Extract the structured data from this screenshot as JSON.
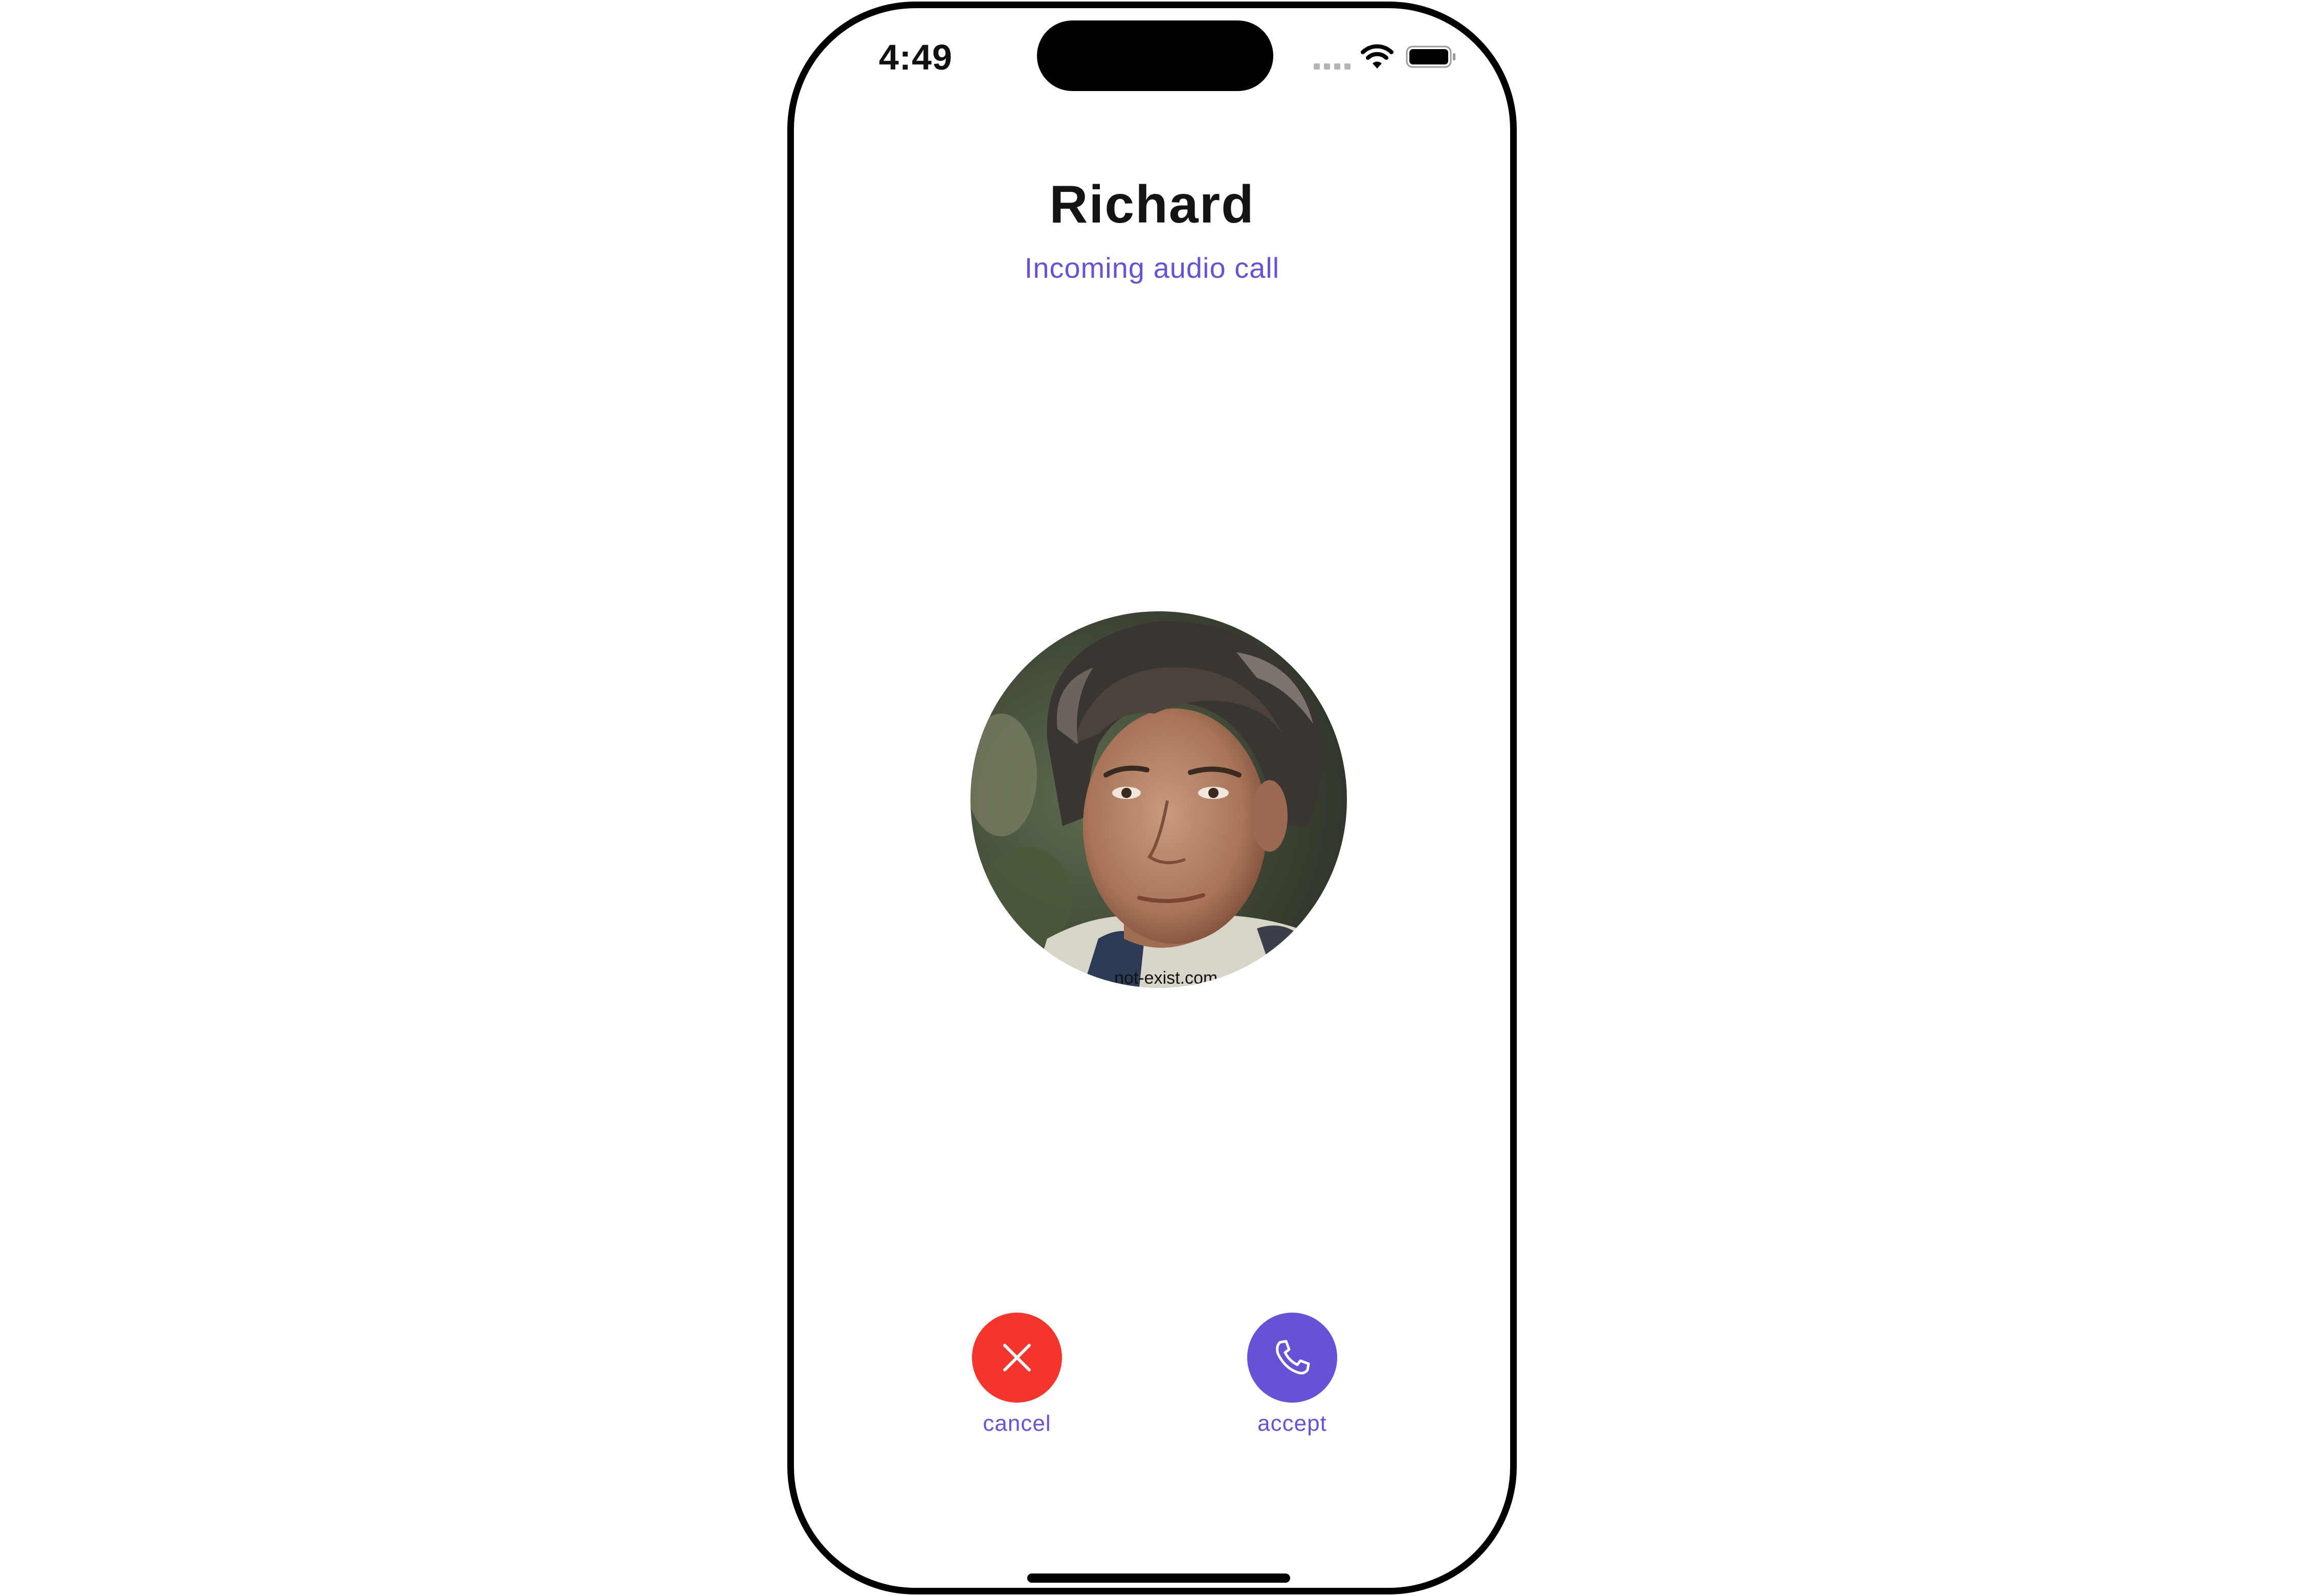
{
  "status_bar": {
    "time": "4:49",
    "icons": [
      "cellular-signal-icon",
      "wifi-icon",
      "battery-icon"
    ]
  },
  "call": {
    "caller_name": "Richard",
    "status_text": "Incoming audio call",
    "avatar_icon": "caller-avatar-photo",
    "avatar_watermark": "...not-exist.com"
  },
  "actions": {
    "cancel": {
      "label": "cancel",
      "icon": "close-icon",
      "color": "#f4352c"
    },
    "accept": {
      "label": "accept",
      "icon": "phone-icon",
      "color": "#6851d6"
    }
  },
  "theme": {
    "accent": "#6851d6",
    "danger": "#f4352c"
  }
}
